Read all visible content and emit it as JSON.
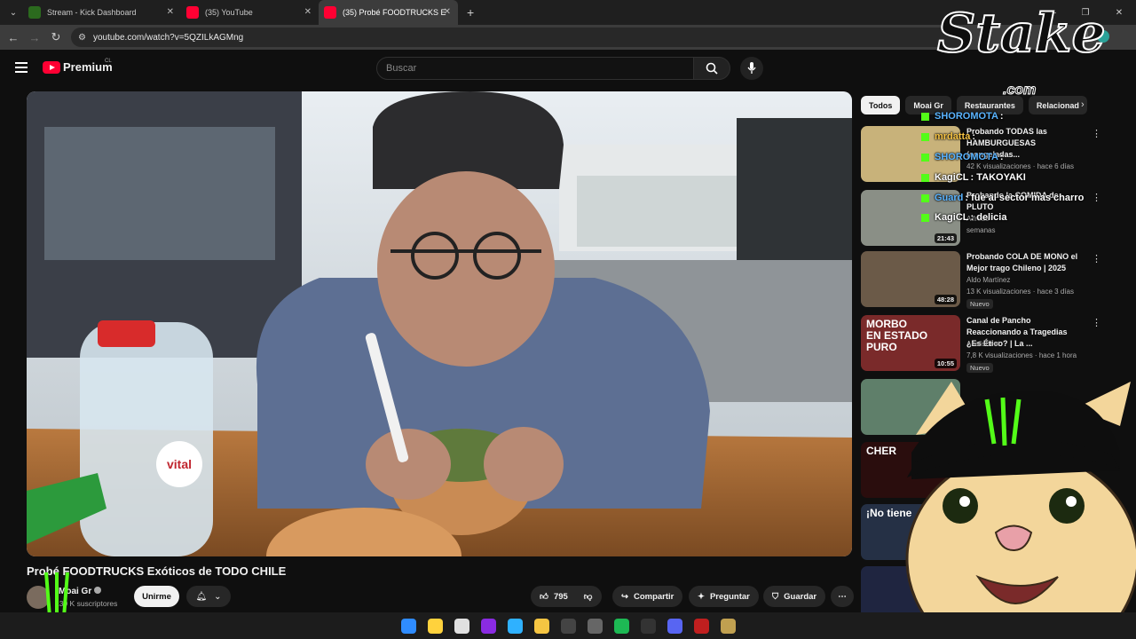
{
  "tabs": [
    {
      "title": "Stream - Kick Dashboard",
      "favicon_color": "#53fc18"
    },
    {
      "title": "(35) YouTube",
      "favicon_color": "#ff0033"
    },
    {
      "title": "(35) Probé FOODTRUCKS E",
      "favicon_color": "#ff0033"
    }
  ],
  "address": {
    "url": "youtube.com/watch?v=5QZILkAGMng"
  },
  "youtube": {
    "logo": "Premium",
    "country": "CL",
    "search_placeholder": "Buscar"
  },
  "video": {
    "title": "Probé FOODTRUCKS Exóticos de TODO CHILE",
    "channel": "Moai Gr",
    "subscribers": "139 K suscriptores",
    "join_label": "Unirme",
    "likes": "795",
    "share_label": "Compartir",
    "ask_label": "Preguntar",
    "save_label": "Guardar"
  },
  "chips": [
    "Todos",
    "Moai Gr",
    "Restaurantes",
    "Relacionad"
  ],
  "recommendations": [
    {
      "title": "Probando TODAS las HAMBURGUESAS (congeladas...",
      "channel": "",
      "meta": "42 K visualizaciones · hace 6 días",
      "duration": "",
      "badge": "",
      "thumb": "#c8b27a"
    },
    {
      "title": "Probando la COMIDA de PLUTO",
      "channel": "Alfredo",
      "meta": "semanas",
      "duration": "21:43",
      "badge": "",
      "thumb": "#8a8f86"
    },
    {
      "title": "Probando COLA DE MONO el Mejor trago Chileno | 2025",
      "channel": "Aldo Martínez",
      "meta": "13 K visualizaciones · hace 3 días",
      "duration": "48:28",
      "badge": "Nuevo",
      "thumb": "#6b5a48"
    },
    {
      "title": "Canal de Pancho Reaccionando a Tragedias ¿Es Ético? | La ...",
      "channel": "Analisheet",
      "meta": "7,8 K visualizaciones · hace 1 hora",
      "duration": "10:55",
      "badge": "Nuevo",
      "thumb": "#7a2a2a",
      "thumb_text": [
        "MORBO",
        "EN ESTADO",
        "PURO"
      ]
    },
    {
      "title": "",
      "channel": "",
      "meta": "",
      "duration": "",
      "badge": "",
      "thumb": "#5f7f6a"
    },
    {
      "title": "",
      "channel": "",
      "meta": "",
      "duration": "",
      "badge": "",
      "thumb": "#2a0d0d",
      "thumb_text": [
        "CHER"
      ]
    },
    {
      "title": "",
      "channel": "",
      "meta": "",
      "duration": "",
      "badge": "",
      "thumb": "#253045",
      "thumb_text": [
        "¡No tiene"
      ]
    },
    {
      "title": "",
      "channel": "",
      "meta": "",
      "duration": "",
      "badge": "",
      "thumb": "#1f2540"
    }
  ],
  "chat": [
    {
      "user": "SHOROMOTA",
      "text": ":",
      "color": "#5ab4ff"
    },
    {
      "user": "mrdatta",
      "text": ":",
      "color": "#f6c343"
    },
    {
      "user": "SHOROMOTA",
      "text": ":",
      "color": "#5ab4ff"
    },
    {
      "user": "KagiCL",
      "text": ": TAKOYAKI",
      "color": "#ffffff"
    },
    {
      "user": "Guard",
      "text": ": fue al sector mas charro",
      "color": "#5ab4ff"
    },
    {
      "user": "KagiCL",
      "text": ": delicia",
      "color": "#ffffff"
    }
  ],
  "overlay": {
    "brand": "Stake",
    "brand_suffix": ".com",
    "cap_logo_color": "#53fc18"
  },
  "bottle_label": "vital",
  "taskbar_icons": [
    "windows",
    "folder-ring",
    "chrome",
    "inkscape",
    "file",
    "explorer",
    "capcut",
    "code",
    "spotify",
    "github",
    "discord",
    "rockstar",
    "league"
  ]
}
